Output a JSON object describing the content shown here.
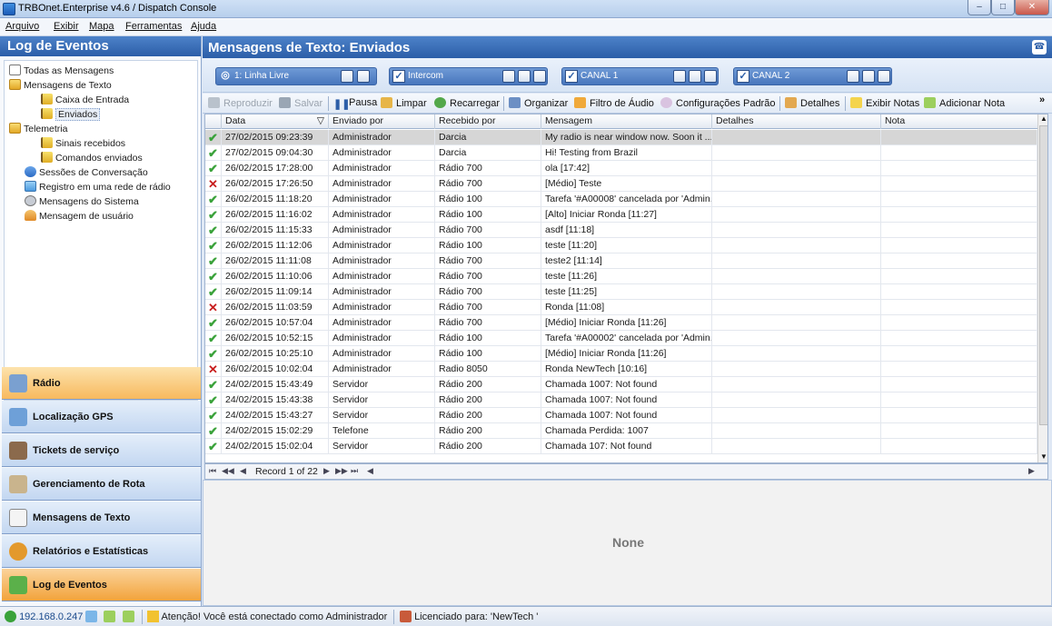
{
  "window": {
    "title": "TRBOnet.Enterprise v4.6 / Dispatch Console",
    "min": "–",
    "max": "□",
    "close": "✕"
  },
  "menu": [
    "Arquivo",
    "Exibir",
    "Mapa",
    "Ferramentas",
    "Ajuda"
  ],
  "sidebar": {
    "title": "Log de Eventos",
    "tree": [
      {
        "label": "Todas as Mensagens",
        "icon": "mail-stack-icon"
      },
      {
        "label": "Mensagens de Texto",
        "icon": "folder-icon"
      },
      {
        "label": "Caixa de Entrada",
        "icon": "inbox-icon"
      },
      {
        "label": "Enviados",
        "icon": "sent-icon"
      },
      {
        "label": "Telemetria",
        "icon": "folder-icon"
      },
      {
        "label": "Sinais recebidos",
        "icon": "signal-icon"
      },
      {
        "label": "Comandos enviados",
        "icon": "command-icon"
      },
      {
        "label": "Sessões de Conversação",
        "icon": "chat-icon"
      },
      {
        "label": "Registro em uma rede de rádio",
        "icon": "network-icon"
      },
      {
        "label": "Mensagens do Sistema",
        "icon": "system-icon"
      },
      {
        "label": "Mensagem de usuário",
        "icon": "user-icon"
      }
    ],
    "nav": [
      {
        "label": "Rádio",
        "icon": "radio-icon"
      },
      {
        "label": "Localização GPS",
        "icon": "gps-icon"
      },
      {
        "label": "Tickets de serviço",
        "icon": "tickets-icon"
      },
      {
        "label": "Gerenciamento de Rota",
        "icon": "route-icon"
      },
      {
        "label": "Mensagens de Texto",
        "icon": "envelope-icon"
      },
      {
        "label": "Relatórios e Estatísticas",
        "icon": "reports-icon"
      },
      {
        "label": "Log de Eventos",
        "icon": "event-log-icon"
      }
    ]
  },
  "main": {
    "title": "Mensagens de Texto: Enviados",
    "channels": [
      {
        "label": "1: Linha Livre",
        "checked": false
      },
      {
        "label": "Intercom",
        "checked": true
      },
      {
        "label": "CANAL 1",
        "checked": true
      },
      {
        "label": "CANAL 2",
        "checked": true
      }
    ],
    "toolbar": {
      "reproduzir": "Reproduzir",
      "salvar": "Salvar",
      "pausa": "Pausa",
      "limpar": "Limpar",
      "recarregar": "Recarregar",
      "organizar": "Organizar",
      "filtro": "Filtro de Áudio",
      "config": "Configurações Padrão",
      "detalhes": "Detalhes",
      "exibir_notas": "Exibir Notas",
      "adicionar_nota": "Adicionar Nota",
      "overflow": "»"
    },
    "columns": [
      "Data",
      "Enviado por",
      "Recebido por",
      "Mensagem",
      "Detalhes",
      "Nota"
    ],
    "rows": [
      {
        "status": "ok",
        "date": "27/02/2015 09:23:39",
        "from": "Administrador",
        "to": "Darcia",
        "msg": "My radio is near window now. Soon it ..."
      },
      {
        "status": "ok",
        "date": "27/02/2015 09:04:30",
        "from": "Administrador",
        "to": "Darcia",
        "msg": "Hi! Testing from Brazil"
      },
      {
        "status": "ok",
        "date": "26/02/2015 17:28:00",
        "from": "Administrador",
        "to": "Rádio 700",
        "msg": "ola [17:42]"
      },
      {
        "status": "err",
        "date": "26/02/2015 17:26:50",
        "from": "Administrador",
        "to": "Rádio 700",
        "msg": "[Médio] Teste"
      },
      {
        "status": "ok",
        "date": "26/02/2015 11:18:20",
        "from": "Administrador",
        "to": "Rádio 100",
        "msg": "Tarefa '#A00008' cancelada por 'Admin..."
      },
      {
        "status": "ok",
        "date": "26/02/2015 11:16:02",
        "from": "Administrador",
        "to": "Rádio 100",
        "msg": "[Alto] Iniciar Ronda [11:27]"
      },
      {
        "status": "ok",
        "date": "26/02/2015 11:15:33",
        "from": "Administrador",
        "to": "Rádio 700",
        "msg": "asdf [11:18]"
      },
      {
        "status": "ok",
        "date": "26/02/2015 11:12:06",
        "from": "Administrador",
        "to": "Rádio 100",
        "msg": "teste [11:20]"
      },
      {
        "status": "ok",
        "date": "26/02/2015 11:11:08",
        "from": "Administrador",
        "to": "Rádio 700",
        "msg": "teste2 [11:14]"
      },
      {
        "status": "ok",
        "date": "26/02/2015 11:10:06",
        "from": "Administrador",
        "to": "Rádio 700",
        "msg": "teste [11:26]"
      },
      {
        "status": "ok",
        "date": "26/02/2015 11:09:14",
        "from": "Administrador",
        "to": "Rádio 700",
        "msg": "teste [11:25]"
      },
      {
        "status": "err",
        "date": "26/02/2015 11:03:59",
        "from": "Administrador",
        "to": "Rádio 700",
        "msg": "Ronda [11:08]"
      },
      {
        "status": "ok",
        "date": "26/02/2015 10:57:04",
        "from": "Administrador",
        "to": "Rádio 700",
        "msg": "[Médio] Iniciar Ronda [11:26]"
      },
      {
        "status": "ok",
        "date": "26/02/2015 10:52:15",
        "from": "Administrador",
        "to": "Rádio 100",
        "msg": "Tarefa '#A00002' cancelada por 'Admin..."
      },
      {
        "status": "ok",
        "date": "26/02/2015 10:25:10",
        "from": "Administrador",
        "to": "Rádio 100",
        "msg": "[Médio] Iniciar Ronda [11:26]"
      },
      {
        "status": "err",
        "date": "26/02/2015 10:02:04",
        "from": "Administrador",
        "to": "Radio 8050",
        "msg": "Ronda NewTech [10:16]"
      },
      {
        "status": "ok",
        "date": "24/02/2015 15:43:49",
        "from": "Servidor",
        "to": "Rádio 200",
        "msg": "Chamada 1007: Not found"
      },
      {
        "status": "ok",
        "date": "24/02/2015 15:43:38",
        "from": "Servidor",
        "to": "Rádio 200",
        "msg": "Chamada 1007: Not found"
      },
      {
        "status": "ok",
        "date": "24/02/2015 15:43:27",
        "from": "Servidor",
        "to": "Rádio 200",
        "msg": "Chamada 1007: Not found"
      },
      {
        "status": "ok",
        "date": "24/02/2015 15:02:29",
        "from": "Telefone",
        "to": "Rádio 200",
        "msg": "Chamada Perdida: 1007"
      },
      {
        "status": "ok",
        "date": "24/02/2015 15:02:04",
        "from": "Servidor",
        "to": "Rádio 200",
        "msg": "Chamada 107: Not found"
      }
    ],
    "pager": {
      "text": "Record 1 of 22"
    },
    "detail": "None"
  },
  "status": {
    "ip": "192.168.0.247",
    "warning": "Atenção! Você está conectado como Administrador",
    "license": "Licenciado para: 'NewTech '"
  }
}
